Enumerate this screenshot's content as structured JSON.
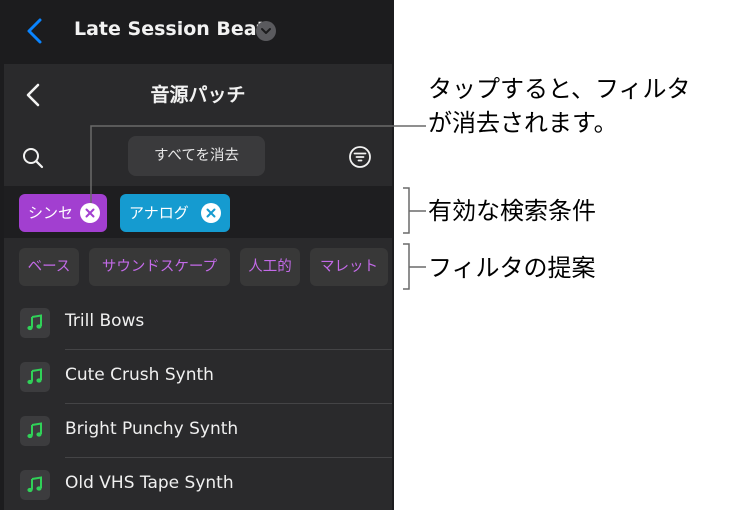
{
  "header": {
    "project_title": "Late Session Beat",
    "back_icon": "chevron-left-icon",
    "dropdown_icon": "chevron-down-icon",
    "accent_color": "#0a84ff"
  },
  "panel": {
    "title": "音源パッチ",
    "back_icon": "chevron-left-icon",
    "search_icon": "search-icon",
    "clear_all_label": "すべてを消去",
    "filter_icon": "filter-icon"
  },
  "active_filters": [
    {
      "label": "シンセ",
      "color": "#a23fd0"
    },
    {
      "label": "アナログ",
      "color": "#159bd0"
    }
  ],
  "suggested_filters": [
    "ベース",
    "サウンドスケープ",
    "人工的",
    "マレット"
  ],
  "suggested_color": "#c36ae8",
  "patches": [
    {
      "name": "Trill Bows"
    },
    {
      "name": "Cute Crush Synth"
    },
    {
      "name": "Bright Punchy Synth"
    },
    {
      "name": "Old VHS Tape Synth"
    }
  ],
  "patch_icon": "music-note-icon",
  "patch_icon_color": "#30d158",
  "callouts": {
    "clear_line1": "タップすると、フィルタ",
    "clear_line2": "が消去されます。",
    "active": "有効な検索条件",
    "suggestions": "フィルタの提案"
  }
}
